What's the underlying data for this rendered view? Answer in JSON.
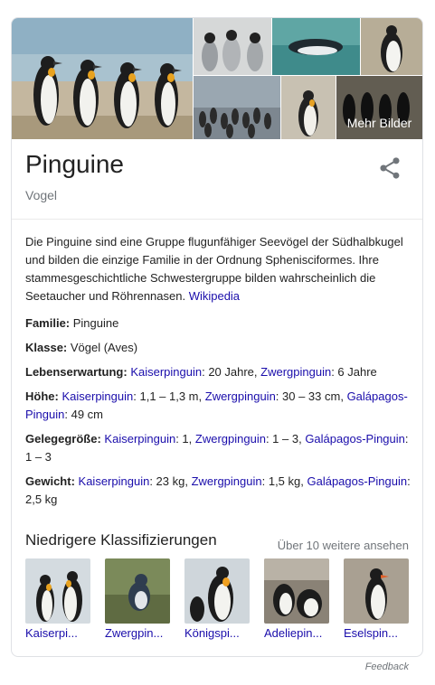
{
  "gallery": {
    "more_label": "Mehr Bilder"
  },
  "entity": {
    "title": "Pinguine",
    "subtitle": "Vogel",
    "share_icon": "share-icon"
  },
  "description": {
    "text": "Die Pinguine sind eine Gruppe flugunfähiger Seevögel der Südhalbkugel und bilden die einzige Familie in der Ordnung Sphenisciformes. Ihre stammesgeschichtliche Schwestergruppe bilden wahrscheinlich die Seetaucher und Röhrennasen. ",
    "source_link": "Wikipedia"
  },
  "facts": {
    "familie": {
      "label": "Familie:",
      "value": " Pinguine"
    },
    "klasse": {
      "label": "Klasse:",
      "value": " Vögel (Aves)"
    },
    "lebenserwartung": {
      "label": "Lebenserwartung:",
      "l1": "Kaiserpinguin",
      "v1": ": 20 Jahre, ",
      "l2": "Zwergpinguin",
      "v2": ": 6 Jahre"
    },
    "hoehe": {
      "label": "Höhe:",
      "l1": "Kaiserpinguin",
      "v1": ": 1,1 – 1,3 m, ",
      "l2": "Zwergpinguin",
      "v2": ": 30 – 33 cm, ",
      "l3": "Galápagos-Pinguin",
      "v3": ": 49 cm"
    },
    "gelege": {
      "label": "Gelegegröße:",
      "l1": "Kaiserpinguin",
      "v1": ": 1, ",
      "l2": "Zwergpinguin",
      "v2": ": 1 – 3, ",
      "l3": "Galápagos-Pinguin",
      "v3": ": 1 – 3"
    },
    "gewicht": {
      "label": "Gewicht:",
      "l1": "Kaiserpinguin",
      "v1": ": 23 kg, ",
      "l2": "Zwergpinguin",
      "v2": ": 1,5 kg, ",
      "l3": "Galápagos-Pinguin",
      "v3": ": 2,5 kg"
    }
  },
  "classifications": {
    "title": "Niedrigere Klassifizierungen",
    "more_link": "Über 10 weitere ansehen",
    "items": [
      {
        "label": "Kaiserpi..."
      },
      {
        "label": "Zwergpin..."
      },
      {
        "label": "Königspi..."
      },
      {
        "label": "Adeliepin..."
      },
      {
        "label": "Eselspin..."
      }
    ]
  },
  "footer": {
    "feedback": "Feedback"
  }
}
